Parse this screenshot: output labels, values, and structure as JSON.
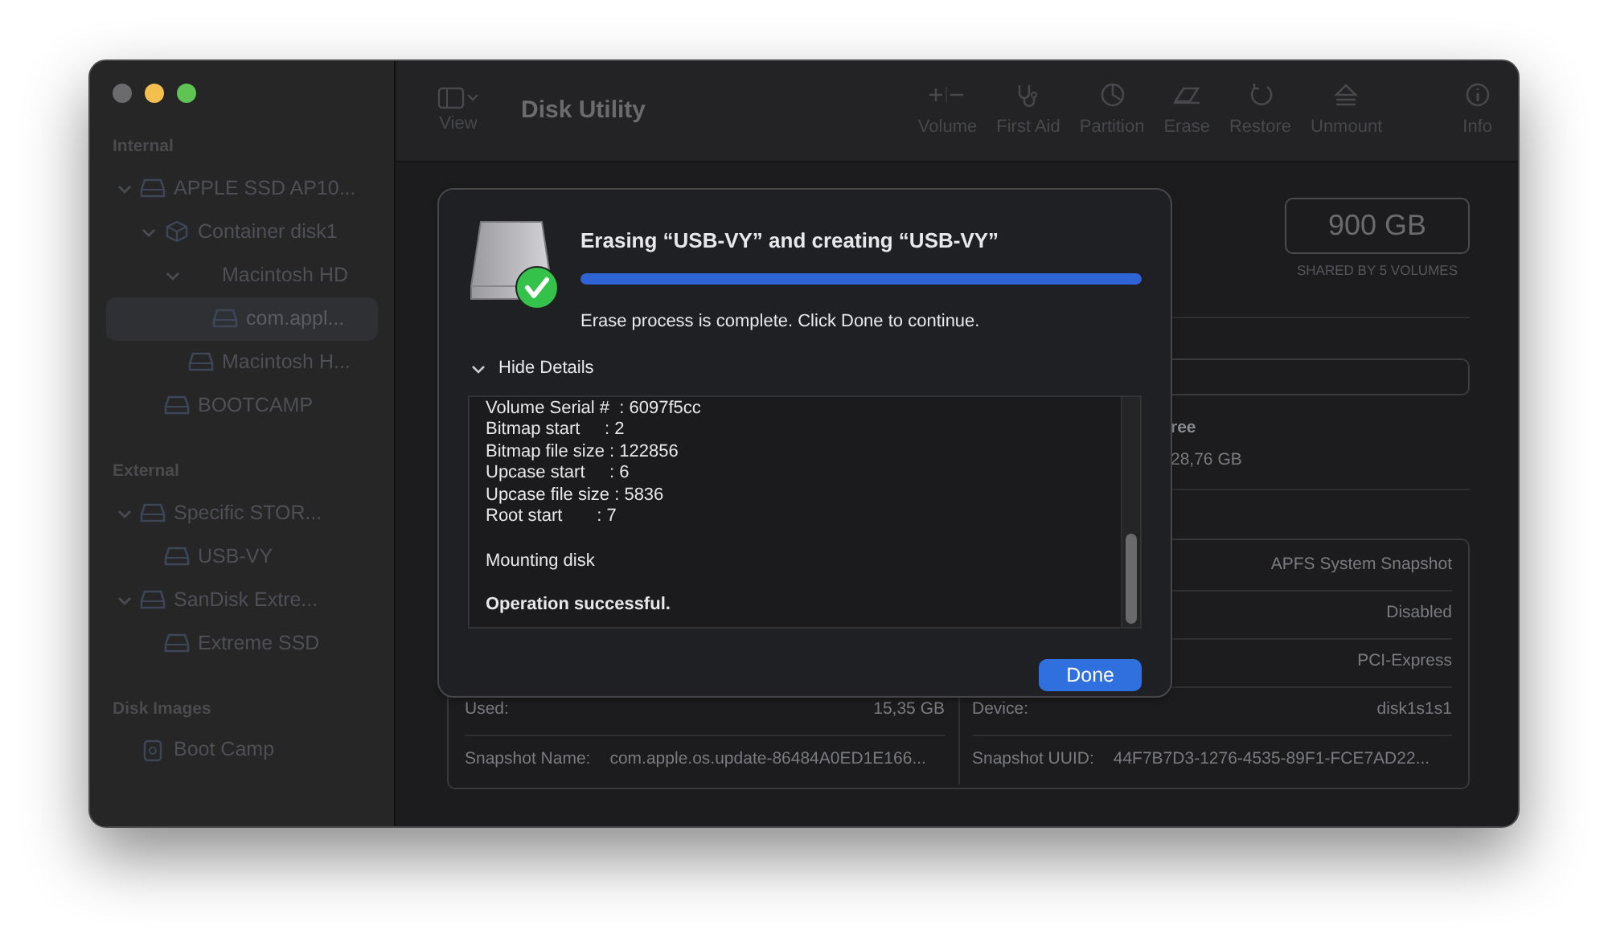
{
  "window": {
    "title": "Disk Utility"
  },
  "toolbar": {
    "view_label": "View",
    "items": [
      {
        "kind": "volume",
        "label": "Volume"
      },
      {
        "kind": "first_aid",
        "label": "First Aid"
      },
      {
        "kind": "partition",
        "label": "Partition"
      },
      {
        "kind": "erase",
        "label": "Erase"
      },
      {
        "kind": "restore",
        "label": "Restore"
      },
      {
        "kind": "unmount",
        "label": "Unmount"
      },
      {
        "kind": "info",
        "label": "Info"
      }
    ]
  },
  "sidebar": {
    "sections": [
      {
        "title": "Internal",
        "items": [
          {
            "label": "APPLE SSD AP10...",
            "kind": "disk",
            "expanded": true,
            "selected": false,
            "children": [
              {
                "label": "Container disk1",
                "kind": "container",
                "expanded": true,
                "selected": false,
                "children": [
                  {
                    "label": "Macintosh HD",
                    "kind": "group",
                    "expanded": true,
                    "selected": false,
                    "children": [
                      {
                        "label": "com.appl...",
                        "kind": "disk",
                        "selected": true
                      }
                    ]
                  },
                  {
                    "label": "Macintosh H...",
                    "kind": "disk",
                    "selected": false
                  }
                ]
              },
              {
                "label": "BOOTCAMP",
                "kind": "disk",
                "selected": false
              }
            ]
          }
        ]
      },
      {
        "title": "External",
        "items": [
          {
            "label": "Specific STOR...",
            "kind": "disk",
            "expanded": true,
            "selected": false,
            "children": [
              {
                "label": "USB-VY",
                "kind": "disk",
                "selected": false
              }
            ]
          },
          {
            "label": "SanDisk Extre...",
            "kind": "disk",
            "expanded": true,
            "selected": false,
            "children": [
              {
                "label": "Extreme SSD",
                "kind": "disk",
                "selected": false
              }
            ]
          }
        ]
      },
      {
        "title": "Disk Images",
        "items": [
          {
            "label": "Boot Camp",
            "kind": "image",
            "selected": false
          }
        ]
      }
    ]
  },
  "volume": {
    "capacity": "900 GB",
    "capacity_note": "SHARED BY 5 VOLUMES",
    "legend_label": "ree",
    "legend_value": "28,76 GB",
    "info_left": [
      {
        "label": "Used:",
        "value": "15,35 GB"
      },
      {
        "label": "Snapshot Name:",
        "value": "com.apple.os.update-86484A0ED1E166..."
      }
    ],
    "info_right": [
      {
        "value": "APFS System Snapshot"
      },
      {
        "value": "Disabled"
      },
      {
        "value": "PCI-Express"
      },
      {
        "label": "Device:",
        "value": "disk1s1s1"
      },
      {
        "label": "Snapshot UUID:",
        "value": "44F7B7D3-1276-4535-89F1-FCE7AD22..."
      }
    ]
  },
  "dialog": {
    "title": "Erasing “USB-VY” and creating “USB-VY”",
    "progress": {
      "level": 1.0
    },
    "message": "Erase process is complete. Click Done to continue.",
    "details_toggle": {
      "label": "Hide Details",
      "expanded": true
    },
    "log": [
      {
        "bold": false,
        "lines": [
          "Volume Serial #  : 6097f5cc",
          "Bitmap start     : 2",
          "Bitmap file size : 122856",
          "Upcase start     : 6",
          "Upcase file size : 5836",
          "Root start       : 7"
        ]
      },
      {
        "bold": false,
        "lines": [
          "Mounting disk"
        ]
      },
      {
        "bold": true,
        "lines": [
          "Operation successful."
        ]
      }
    ],
    "button": "Done"
  }
}
